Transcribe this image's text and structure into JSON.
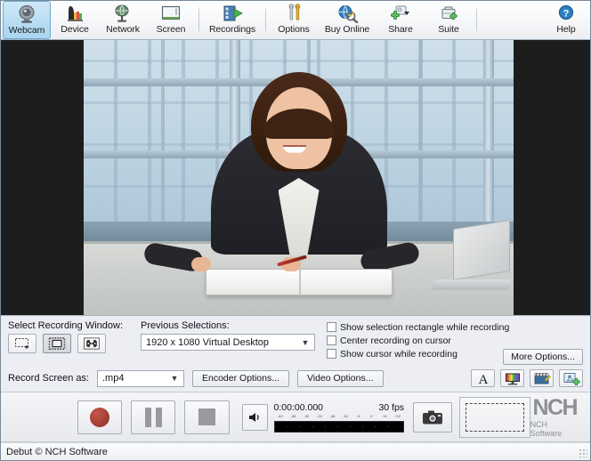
{
  "app": {
    "title": "Debut",
    "status_text": "Debut © NCH Software"
  },
  "toolbar": {
    "items": [
      {
        "label": "Webcam",
        "icon": "webcam-icon",
        "selected": true
      },
      {
        "label": "Device",
        "icon": "device-icon",
        "selected": false
      },
      {
        "label": "Network",
        "icon": "network-icon",
        "selected": false
      },
      {
        "label": "Screen",
        "icon": "screen-icon",
        "selected": false
      },
      {
        "label": "Recordings",
        "icon": "recordings-icon",
        "selected": false
      },
      {
        "label": "Options",
        "icon": "options-icon",
        "selected": false
      },
      {
        "label": "Buy Online",
        "icon": "buy-online-icon",
        "selected": false
      },
      {
        "label": "Share",
        "icon": "share-icon",
        "selected": false,
        "has_dropdown": true
      },
      {
        "label": "Suite",
        "icon": "suite-icon",
        "selected": false
      }
    ],
    "help_label": "Help",
    "help_icon": "help-icon"
  },
  "settings": {
    "select_recording_window_label": "Select Recording Window:",
    "window_buttons": [
      {
        "name": "select-region-button",
        "icon": "dashed-rectangle-icon"
      },
      {
        "name": "select-window-button",
        "icon": "window-frame-icon"
      },
      {
        "name": "select-fullscreen-button",
        "icon": "fullscreen-arrows-icon"
      }
    ],
    "previous_selections_label": "Previous Selections:",
    "previous_selections_value": "1920 x 1080 Virtual Desktop",
    "checkboxes": [
      {
        "label": "Show selection rectangle while recording",
        "checked": false
      },
      {
        "label": "Center recording on cursor",
        "checked": false
      },
      {
        "label": "Show cursor while recording",
        "checked": false
      }
    ],
    "more_options_label": "More Options...",
    "record_screen_as_label": "Record Screen as:",
    "format_value": ".mp4",
    "encoder_options_label": "Encoder Options...",
    "video_options_label": "Video Options...",
    "effect_buttons": [
      {
        "name": "text-overlay-button",
        "icon": "text-a-icon"
      },
      {
        "name": "color-adjust-button",
        "icon": "color-monitor-icon"
      },
      {
        "name": "video-effects-button",
        "icon": "clapperboard-icon"
      },
      {
        "name": "image-overlay-button",
        "icon": "image-overlay-icon"
      }
    ]
  },
  "transport": {
    "record_label": "Record",
    "pause_label": "Pause",
    "stop_label": "Stop",
    "volume_label": "Volume",
    "timecode": "0:00:00.000",
    "fps": "30 fps",
    "meter_ticks": [
      "-42",
      "-36",
      "-30",
      "-24",
      "-18",
      "-12",
      "-6",
      "0",
      "+6",
      "+12"
    ],
    "snapshot_label": "Snapshot"
  },
  "branding": {
    "mark": "NCH",
    "sub": "NCH Software"
  },
  "colors": {
    "accent_selected": "#a9d5ef",
    "record_red": "#8e2f26",
    "panel_bg": "#eceef3",
    "video_bg": "#1e1d1d"
  }
}
